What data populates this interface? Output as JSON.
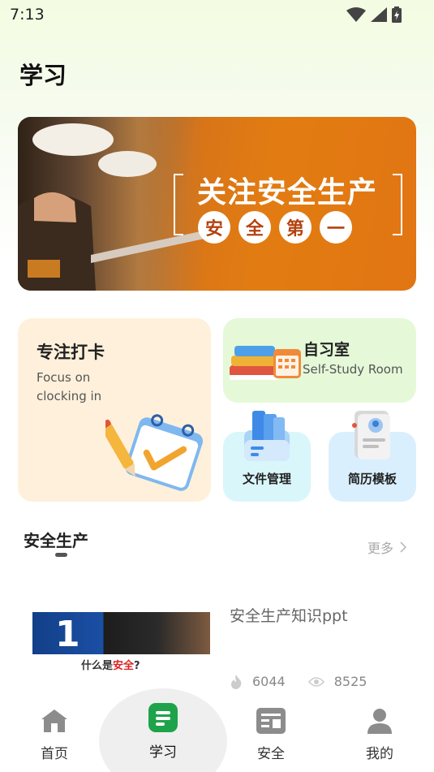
{
  "status_bar": {
    "time": "7:13"
  },
  "page": {
    "title": "学习"
  },
  "banner": {
    "title": "关注安全生产",
    "circles": [
      "安",
      "全",
      "第",
      "一"
    ]
  },
  "cards": {
    "focus": {
      "title": "专注打卡",
      "subtitle": "Focus on clocking in"
    },
    "study_room": {
      "title": "自习室",
      "subtitle": "Self-Study Room"
    },
    "file_management": {
      "title": "文件管理"
    },
    "resume_template": {
      "title": "简历模板"
    }
  },
  "section": {
    "title": "安全生产",
    "more_label": "更多"
  },
  "article": {
    "title": "安全生产知识ppt",
    "likes": "6044",
    "views": "8525",
    "thumbnail": {
      "number": "1",
      "caption_prefix": "什么是",
      "caption_highlight": "安全",
      "caption_suffix": "?"
    }
  },
  "tabs": [
    {
      "label": "首页",
      "icon": "home-icon"
    },
    {
      "label": "学习",
      "icon": "study-icon",
      "active": true
    },
    {
      "label": "安全",
      "icon": "safety-icon"
    },
    {
      "label": "我的",
      "icon": "profile-icon"
    }
  ],
  "colors": {
    "accent_green": "#1fa34a",
    "banner_orange": "#e27c12"
  }
}
